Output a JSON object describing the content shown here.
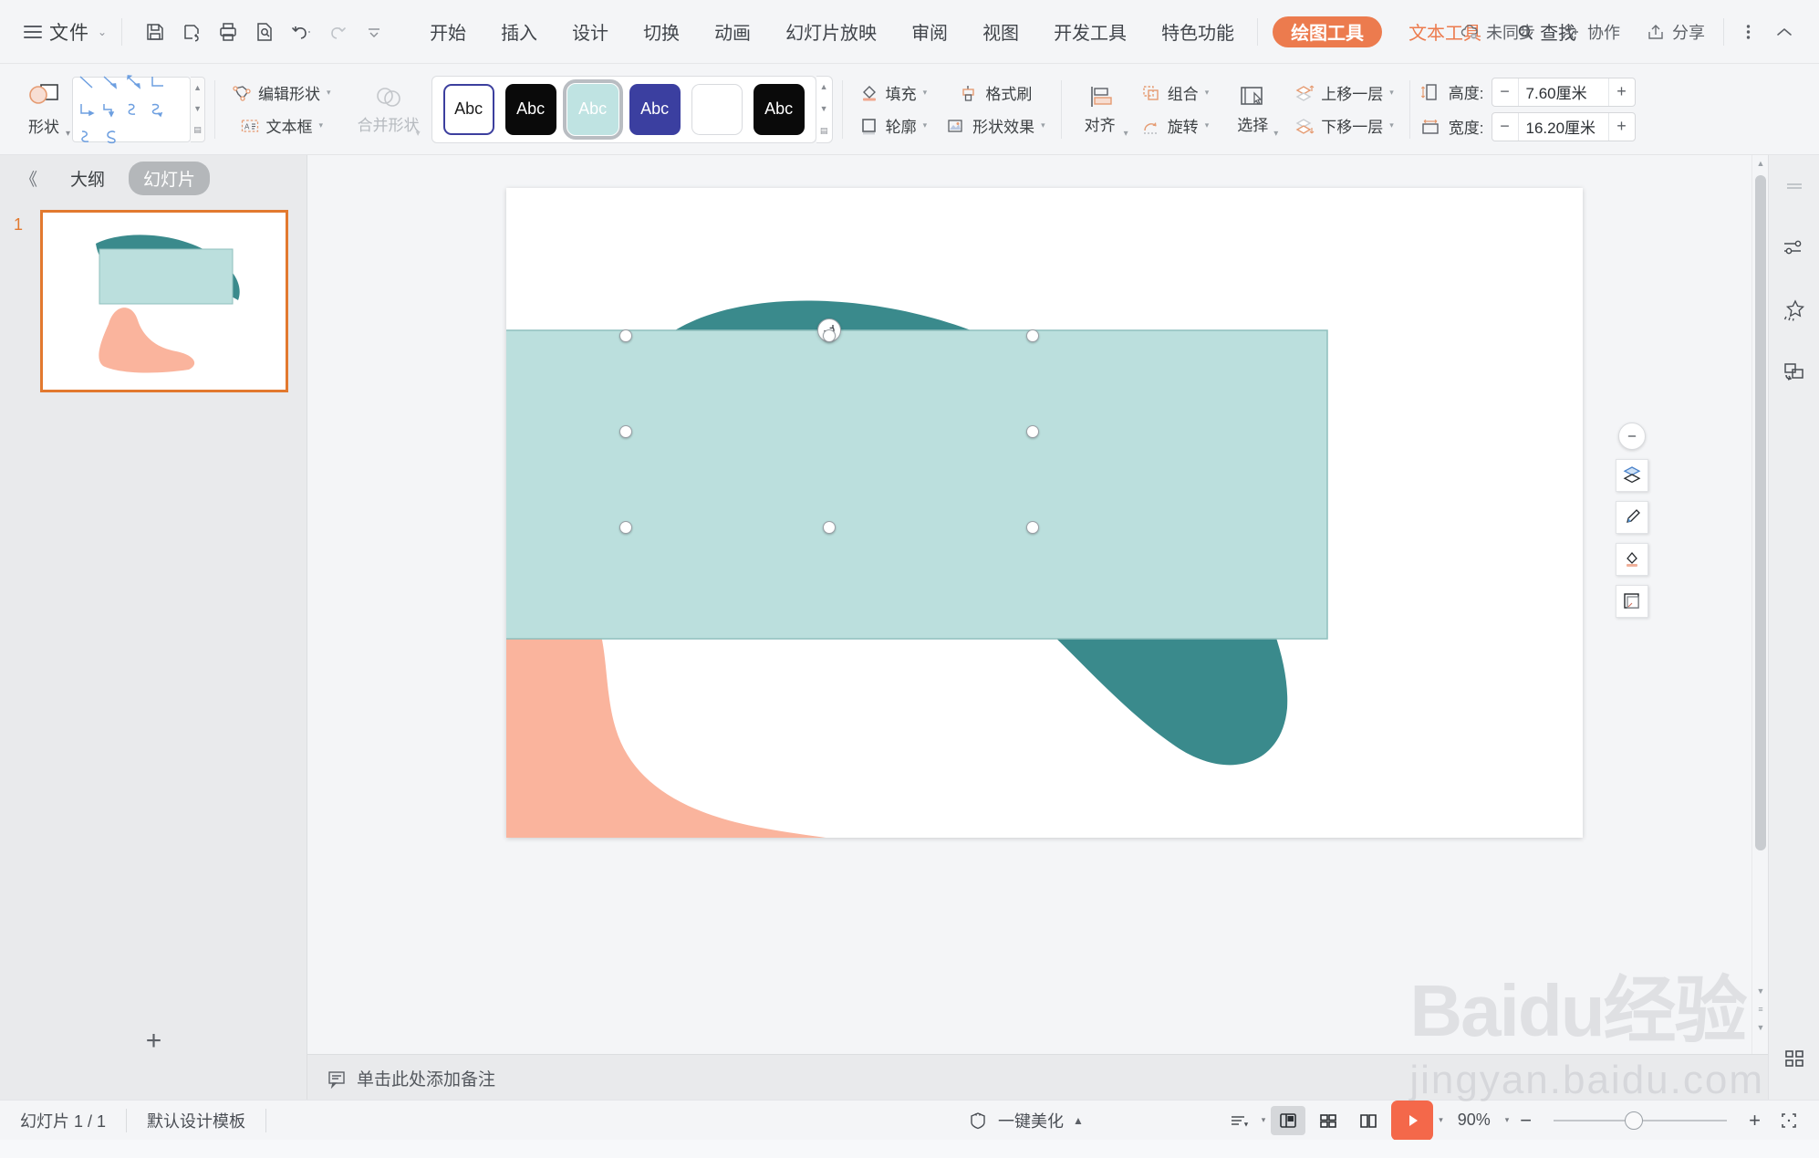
{
  "menubar": {
    "file_label": "文件",
    "quick_icons": [
      "save-icon",
      "save-as-icon",
      "print-icon",
      "print-preview-icon",
      "undo-icon",
      "redo-icon",
      "customize-icon"
    ],
    "tabs": [
      {
        "label": "开始",
        "style": "normal"
      },
      {
        "label": "插入",
        "style": "normal"
      },
      {
        "label": "设计",
        "style": "normal"
      },
      {
        "label": "切换",
        "style": "normal"
      },
      {
        "label": "动画",
        "style": "normal"
      },
      {
        "label": "幻灯片放映",
        "style": "normal"
      },
      {
        "label": "审阅",
        "style": "normal"
      },
      {
        "label": "视图",
        "style": "normal"
      },
      {
        "label": "开发工具",
        "style": "normal"
      },
      {
        "label": "特色功能",
        "style": "normal"
      },
      {
        "label": "绘图工具",
        "style": "pill"
      },
      {
        "label": "文本工具",
        "style": "orange"
      },
      {
        "label": "查找",
        "style": "find"
      }
    ],
    "right_items": [
      {
        "label": "未同步",
        "icon": "cloud-unsync-icon"
      },
      {
        "label": "协作",
        "icon": "collaborate-icon"
      },
      {
        "label": "分享",
        "icon": "share-icon"
      }
    ],
    "more_icon": "more-vertical-icon",
    "collapse_icon": "chevron-up-icon",
    "accent_color": "#ec7b4e"
  },
  "ribbon": {
    "shape_button": {
      "label": "形状",
      "icon": "shape-icon"
    },
    "line_gallery": {
      "name": "line-shapes-gallery",
      "items": [
        "line",
        "line-arrow",
        "line-double-arrow",
        "elbow-connector",
        "elbow-arrow",
        "elbow-down",
        "curve-1",
        "curve-2",
        "curve-3",
        "curve-s"
      ]
    },
    "edit_shape": {
      "label": "编辑形状",
      "icon": "edit-shape-icon"
    },
    "text_box": {
      "label": "文本框",
      "icon": "text-box-icon"
    },
    "merge_shapes": {
      "label": "合并形状",
      "icon": "merge-shapes-icon",
      "disabled": true
    },
    "style_gallery": {
      "swatches": [
        {
          "name": "style-white-blue-border",
          "fill": "#ffffff",
          "text": "#1d1d1d",
          "border": "#3c3f9e",
          "label": "Abc"
        },
        {
          "name": "style-black",
          "fill": "#0a0a0a",
          "text": "#ffffff",
          "border": "#0a0a0a",
          "label": "Abc"
        },
        {
          "name": "style-light-teal",
          "fill": "#bfe3e2",
          "text": "#ffffff",
          "border": "#bfe3e2",
          "label": "Abc",
          "selected": true
        },
        {
          "name": "style-indigo",
          "fill": "#3b3fa0",
          "text": "#ffffff",
          "border": "#3b3fa0",
          "label": "Abc"
        },
        {
          "name": "style-blank-white",
          "fill": "#ffffff",
          "text": "#ffffff",
          "border": "#d8dade",
          "label": ""
        },
        {
          "name": "style-black-2",
          "fill": "#0a0a0a",
          "text": "#ffffff",
          "border": "#0a0a0a",
          "label": "Abc"
        }
      ]
    },
    "fill": {
      "label": "填充",
      "icon": "fill-bucket-icon"
    },
    "outline": {
      "label": "轮廓",
      "icon": "outline-icon"
    },
    "format_painter": {
      "label": "格式刷",
      "icon": "format-painter-icon"
    },
    "shape_effects": {
      "label": "形状效果",
      "icon": "shape-effects-icon"
    },
    "align": {
      "label": "对齐",
      "icon": "align-icon"
    },
    "group": {
      "label": "组合",
      "icon": "group-icon"
    },
    "rotate": {
      "label": "旋转",
      "icon": "rotate-icon"
    },
    "select": {
      "label": "选择",
      "icon": "select-objects-icon"
    },
    "bring_forward": {
      "label": "上移一层",
      "icon": "bring-forward-icon"
    },
    "send_backward": {
      "label": "下移一层",
      "icon": "send-backward-icon"
    },
    "height": {
      "label": "高度:",
      "value": "7.60厘米",
      "minus": "−",
      "plus": "+",
      "icon": "height-icon"
    },
    "width": {
      "label": "宽度:",
      "value": "16.20厘米",
      "minus": "−",
      "plus": "+",
      "icon": "width-icon"
    }
  },
  "left_panel": {
    "collapse_label": "《",
    "tab_outline": "大纲",
    "tab_slides": "幻灯片",
    "slide_number": "1",
    "add_slide_label": "+"
  },
  "canvas": {
    "slide_shapes": {
      "teal_color": "#3a8a8c",
      "peach_color": "#fab49d",
      "rect_fill": "#bbdfdd",
      "rect_border": "#8fbfbd"
    },
    "selection": {
      "handles": 8,
      "rotate_icon": "rotate-handle-icon"
    },
    "shape_toolbar": [
      {
        "name": "minimize-toolbar-button",
        "icon": "minus-circle-icon"
      },
      {
        "name": "layer-order-button",
        "icon": "layers-icon"
      },
      {
        "name": "style-brush-button",
        "icon": "brush-icon"
      },
      {
        "name": "fill-color-button",
        "icon": "fill-bucket-icon"
      },
      {
        "name": "size-position-button",
        "icon": "frame-icon"
      }
    ]
  },
  "right_rail": [
    {
      "name": "rail-drag-handle",
      "icon": "drag-handle-icon"
    },
    {
      "name": "rail-properties",
      "icon": "sliders-icon"
    },
    {
      "name": "rail-beautify",
      "icon": "magic-star-icon"
    },
    {
      "name": "rail-replace-image",
      "icon": "swap-images-icon"
    },
    {
      "name": "rail-grid-view",
      "icon": "grid-apps-icon"
    }
  ],
  "notes": {
    "placeholder": "单击此处添加备注",
    "icon": "notes-icon"
  },
  "status": {
    "slide_count": "幻灯片 1 / 1",
    "template": "默认设计模板",
    "beautify": {
      "label": "一键美化",
      "icon": "beautify-icon",
      "caret": "▲"
    },
    "view_buttons": [
      {
        "name": "view-list-button",
        "icon": "list-view-icon"
      },
      {
        "name": "view-normal-button",
        "icon": "normal-view-icon",
        "active": true
      },
      {
        "name": "view-sorter-button",
        "icon": "slide-sorter-icon"
      },
      {
        "name": "view-reading-button",
        "icon": "reading-view-icon"
      }
    ],
    "play_button": {
      "name": "start-slideshow-button",
      "icon": "play-icon"
    },
    "zoom": {
      "level": "90%",
      "minus": "−",
      "plus": "+",
      "fit_icon": "fit-screen-icon"
    }
  },
  "watermark": {
    "line1": "Baidu经验",
    "line2": "jingyan.baidu.com"
  }
}
